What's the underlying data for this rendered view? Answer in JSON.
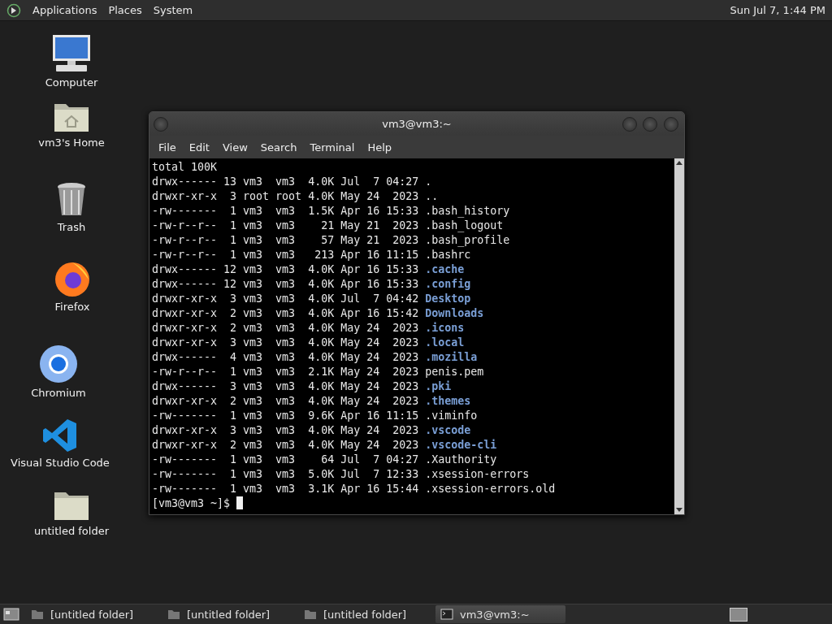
{
  "top_panel": {
    "menus": [
      "Applications",
      "Places",
      "System"
    ],
    "clock": "Sun Jul 7, 1:44 PM"
  },
  "desktop_icons": [
    {
      "kind": "computer",
      "label": "Computer"
    },
    {
      "kind": "home",
      "label": "vm3's Home"
    },
    {
      "kind": "trash",
      "label": "Trash"
    },
    {
      "kind": "firefox",
      "label": "Firefox"
    },
    {
      "kind": "chromium",
      "label": "Chromium"
    },
    {
      "kind": "vscode",
      "label": "Visual Studio Code"
    },
    {
      "kind": "folder",
      "label": "untitled folder"
    }
  ],
  "terminal": {
    "title": "vm3@vm3:~",
    "menu": [
      "File",
      "Edit",
      "View",
      "Search",
      "Terminal",
      "Help"
    ],
    "lines": [
      {
        "kind": "plain",
        "text": "total 100K"
      },
      {
        "kind": "file",
        "text": "drwx------ 13 vm3  vm3  4.0K Jul  7 04:27 ",
        "name": "."
      },
      {
        "kind": "file",
        "text": "drwxr-xr-x  3 root root 4.0K May 24  2023 ",
        "name": ".."
      },
      {
        "kind": "file",
        "text": "-rw-------  1 vm3  vm3  1.5K Apr 16 15:33 ",
        "name": ".bash_history"
      },
      {
        "kind": "file",
        "text": "-rw-r--r--  1 vm3  vm3    21 May 21  2023 ",
        "name": ".bash_logout"
      },
      {
        "kind": "file",
        "text": "-rw-r--r--  1 vm3  vm3    57 May 21  2023 ",
        "name": ".bash_profile"
      },
      {
        "kind": "file",
        "text": "-rw-r--r--  1 vm3  vm3   213 Apr 16 11:15 ",
        "name": ".bashrc"
      },
      {
        "kind": "dir",
        "text": "drwx------ 12 vm3  vm3  4.0K Apr 16 15:33 ",
        "name": ".cache"
      },
      {
        "kind": "dir",
        "text": "drwx------ 12 vm3  vm3  4.0K Apr 16 15:33 ",
        "name": ".config"
      },
      {
        "kind": "dir",
        "text": "drwxr-xr-x  3 vm3  vm3  4.0K Jul  7 04:42 ",
        "name": "Desktop"
      },
      {
        "kind": "dir",
        "text": "drwxr-xr-x  2 vm3  vm3  4.0K Apr 16 15:42 ",
        "name": "Downloads"
      },
      {
        "kind": "dir",
        "text": "drwxr-xr-x  2 vm3  vm3  4.0K May 24  2023 ",
        "name": ".icons"
      },
      {
        "kind": "dir",
        "text": "drwxr-xr-x  3 vm3  vm3  4.0K May 24  2023 ",
        "name": ".local"
      },
      {
        "kind": "dir",
        "text": "drwx------  4 vm3  vm3  4.0K May 24  2023 ",
        "name": ".mozilla"
      },
      {
        "kind": "file",
        "text": "-rw-r--r--  1 vm3  vm3  2.1K May 24  2023 ",
        "name": "penis.pem"
      },
      {
        "kind": "dir",
        "text": "drwx------  3 vm3  vm3  4.0K May 24  2023 ",
        "name": ".pki"
      },
      {
        "kind": "dir",
        "text": "drwxr-xr-x  2 vm3  vm3  4.0K May 24  2023 ",
        "name": ".themes"
      },
      {
        "kind": "file",
        "text": "-rw-------  1 vm3  vm3  9.6K Apr 16 11:15 ",
        "name": ".viminfo"
      },
      {
        "kind": "dir",
        "text": "drwxr-xr-x  3 vm3  vm3  4.0K May 24  2023 ",
        "name": ".vscode"
      },
      {
        "kind": "dir",
        "text": "drwxr-xr-x  2 vm3  vm3  4.0K May 24  2023 ",
        "name": ".vscode-cli"
      },
      {
        "kind": "file",
        "text": "-rw-------  1 vm3  vm3    64 Jul  7 04:27 ",
        "name": ".Xauthority"
      },
      {
        "kind": "file",
        "text": "-rw-------  1 vm3  vm3  5.0K Jul  7 12:33 ",
        "name": ".xsession-errors"
      },
      {
        "kind": "file",
        "text": "-rw-------  1 vm3  vm3  3.1K Apr 16 15:44 ",
        "name": ".xsession-errors.old"
      }
    ],
    "prompt": "[vm3@vm3 ~]$ "
  },
  "taskbar": {
    "tasks": [
      {
        "kind": "folder",
        "label": "[untitled folder]",
        "selected": false
      },
      {
        "kind": "folder",
        "label": "[untitled folder]",
        "selected": false
      },
      {
        "kind": "folder",
        "label": "[untitled folder]",
        "selected": false
      },
      {
        "kind": "terminal",
        "label": "vm3@vm3:~",
        "selected": true
      }
    ]
  }
}
